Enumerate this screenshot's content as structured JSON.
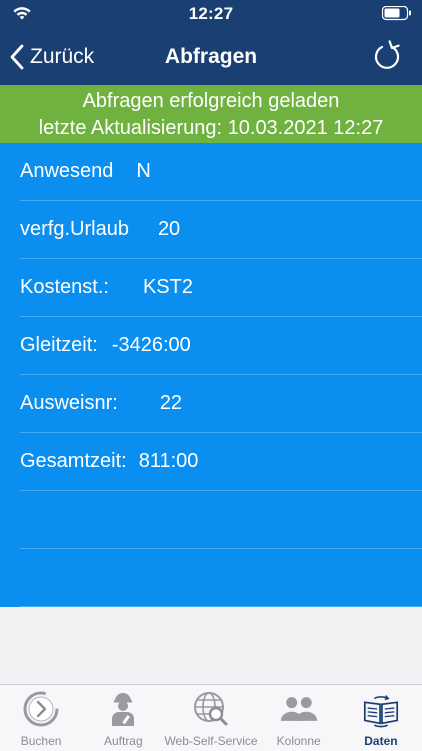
{
  "status": {
    "time": "12:27"
  },
  "nav": {
    "back_label": "Zurück",
    "title": "Abfragen"
  },
  "banner": {
    "line1": "Abfragen erfolgreich geladen",
    "line2": "letzte Aktualisierung: 10.03.2021 12:27",
    "color": "#6fb23f"
  },
  "colors": {
    "header": "#1a3f73",
    "list": "#0a8ff0"
  },
  "rows": [
    {
      "label": "Anwesend",
      "value": "N"
    },
    {
      "label": "verfg.Urlaub",
      "value": "20"
    },
    {
      "label": "Kostenst.:",
      "value": "KST2"
    },
    {
      "label": "Gleitzeit:",
      "value": "-3426:00"
    },
    {
      "label": "Ausweisnr:",
      "value": "22"
    },
    {
      "label": "Gesamtzeit:",
      "value": "811:00"
    },
    {
      "label": "",
      "value": ""
    },
    {
      "label": "",
      "value": ""
    }
  ],
  "tabs": [
    {
      "label": "Buchen",
      "icon": "clock-arrow-icon"
    },
    {
      "label": "Auftrag",
      "icon": "worker-icon"
    },
    {
      "label": "Web-Self-Service",
      "icon": "globe-search-icon"
    },
    {
      "label": "Kolonne",
      "icon": "group-icon"
    },
    {
      "label": "Daten",
      "icon": "book-sync-icon",
      "active": true
    }
  ]
}
